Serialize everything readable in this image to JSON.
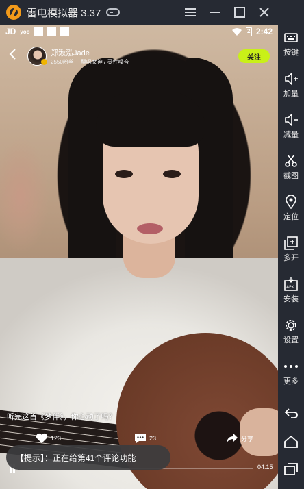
{
  "window": {
    "title": "雷电模拟器 3.37"
  },
  "sidebar": {
    "items": [
      {
        "label": "按键",
        "icon": "keyboard-icon"
      },
      {
        "label": "加量",
        "icon": "volume-up-icon"
      },
      {
        "label": "减量",
        "icon": "volume-down-icon"
      },
      {
        "label": "截图",
        "icon": "scissors-icon"
      },
      {
        "label": "定位",
        "icon": "location-icon"
      },
      {
        "label": "多开",
        "icon": "multi-instance-icon"
      },
      {
        "label": "安装",
        "icon": "install-apk-icon"
      },
      {
        "label": "设置",
        "icon": "gear-icon"
      },
      {
        "label": "更多",
        "icon": "more-icon"
      }
    ],
    "apk_label": "APK"
  },
  "statusbar": {
    "left_app1": "JD",
    "left_app2": "yoo",
    "battery": "2",
    "time": "2:42"
  },
  "streamer": {
    "name": "郑湫泓Jade",
    "fans": "2550粉丝",
    "tag1": "翻唱女神",
    "tag2": "灵性嗓音",
    "follow_label": "关注"
  },
  "video": {
    "caption": "听完这首《梦伴》，你心动了吗？",
    "likes": "123",
    "comments": "23",
    "share_label": "分享",
    "duration": "04:15",
    "progress": 0.05
  },
  "toast": {
    "text": "【提示】：正在给第41个评论功能"
  },
  "colors": {
    "follow": "#c9f018",
    "chrome": "#262a33",
    "logo": "#f29a1a"
  }
}
